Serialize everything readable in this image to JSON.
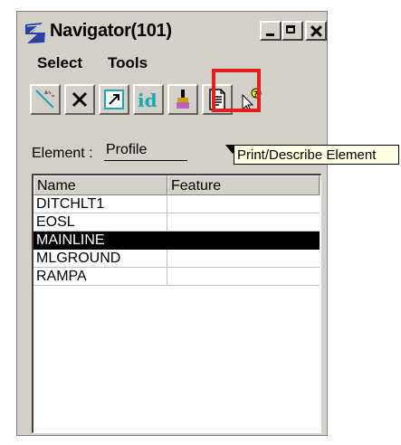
{
  "window": {
    "title": "Navigator(101)"
  },
  "menu": {
    "items": [
      "Select",
      "Tools"
    ]
  },
  "toolbar": {
    "tools": [
      {
        "icon": "select-element-icon"
      },
      {
        "icon": "delete-x-icon"
      },
      {
        "icon": "window-area-icon"
      },
      {
        "icon": "id-text",
        "label": "id"
      },
      {
        "icon": "paint-brush-icon"
      },
      {
        "icon": "print-describe-icon"
      },
      {
        "icon": "help-cursor-icon"
      }
    ],
    "highlight_color": "#e02020"
  },
  "element": {
    "label": "Element :",
    "value": "Profile"
  },
  "tooltip": "Print/Describe Element",
  "list": {
    "columns": [
      "Name",
      "Feature"
    ],
    "rows": [
      {
        "name": "DITCHLT1",
        "feature": ""
      },
      {
        "name": "EOSL",
        "feature": ""
      },
      {
        "name": "MAINLINE",
        "feature": "",
        "selected": true
      },
      {
        "name": "MLGROUND",
        "feature": ""
      },
      {
        "name": "RAMPA",
        "feature": ""
      }
    ]
  }
}
